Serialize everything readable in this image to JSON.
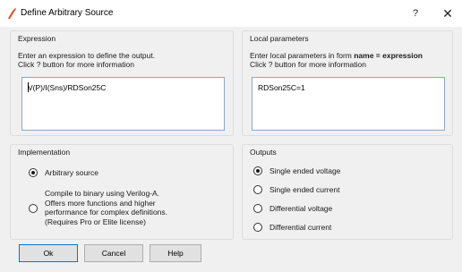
{
  "window": {
    "title": "Define Arbitrary Source",
    "help_glyph": "?",
    "close_glyph": "✕",
    "icon": "ltspice-app-icon",
    "icon_color": "#e8491d"
  },
  "expression": {
    "group_title": "Expression",
    "desc_line1": "Enter an expression to define the output.",
    "desc_line2": "Click ? button for more information",
    "value": "V(P)/I(Sns)/RDSon25C"
  },
  "local_params": {
    "group_title": "Local parameters",
    "desc_prefix": "Enter local parameters in form ",
    "desc_bold": "name = expression",
    "desc_line2": "Click ? button for more information",
    "value": "RDSon25C=1"
  },
  "implementation": {
    "group_title": "Implementation",
    "options": [
      {
        "label": "Arbitrary source",
        "checked": true
      },
      {
        "lines": [
          "Compile to binary using Verilog-A.",
          "Offers more functions and higher",
          "performance for complex definitions.",
          "(Requires Pro or Elite license)"
        ],
        "checked": false
      }
    ]
  },
  "outputs": {
    "group_title": "Outputs",
    "options": [
      {
        "label": "Single ended voltage",
        "checked": true
      },
      {
        "label": "Single ended current",
        "checked": false
      },
      {
        "label": "Differential voltage",
        "checked": false
      },
      {
        "label": "Differential current",
        "checked": false
      }
    ]
  },
  "buttons": {
    "ok": "Ok",
    "cancel": "Cancel",
    "help": "Help"
  },
  "colors": {
    "focus_border": "#0078d7",
    "textbox_border": "#8aa7c9"
  }
}
